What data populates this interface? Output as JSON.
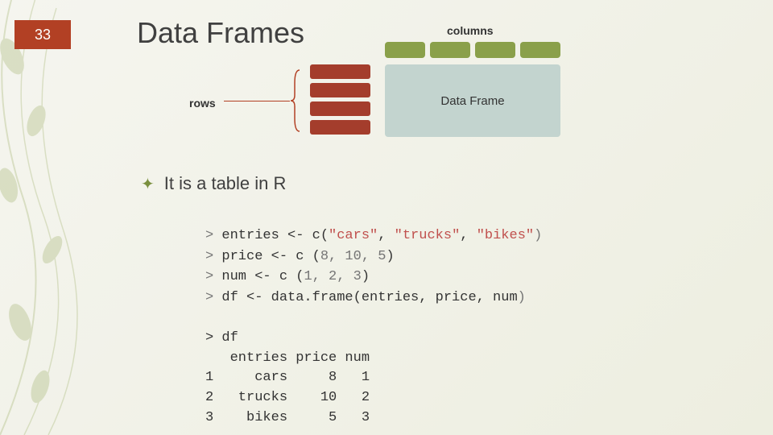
{
  "page_number": "33",
  "title": "Data Frames",
  "diagram": {
    "columns_label": "columns",
    "rows_label": "rows",
    "box_label": "Data Frame"
  },
  "bullet": "It is a table in R",
  "code": {
    "p0": "> ",
    "entries_a": "entries <- c(",
    "entries_b": "\"cars\"",
    "comma": ", ",
    "entries_c": "\"trucks\"",
    "entries_d": "\"bikes\"",
    "entries_e": ")",
    "price_a": "price <- c (",
    "price_b": "8, 10, 5",
    "price_c": ")",
    "num_a": "num <- c (",
    "num_b": "1, 2, 3",
    "num_c": ")",
    "df_a": "df <- data.frame(entries, price, num",
    "df_b": ")"
  },
  "output": {
    "l1": "> df",
    "l2": "   entries price num",
    "l3": "1     cars     8   1",
    "l4": "2   trucks    10   2",
    "l5": "3    bikes     5   3"
  }
}
